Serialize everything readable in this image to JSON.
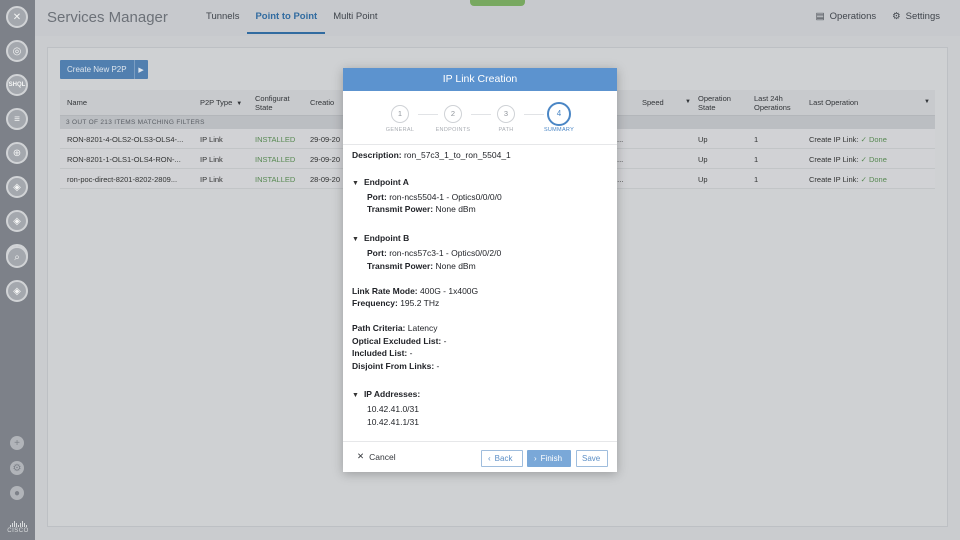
{
  "header": {
    "app_title": "Services Manager",
    "tabs": [
      {
        "label": "Tunnels",
        "active": false
      },
      {
        "label": "Point to Point",
        "active": true
      },
      {
        "label": "Multi Point",
        "active": false
      }
    ],
    "operations_label": "Operations",
    "settings_label": "Settings"
  },
  "rail": {
    "badge_label": "SHQL",
    "brand": "CISCO"
  },
  "main": {
    "create_button_label": "Create New P2P",
    "columns": [
      "Name",
      "P2P Type",
      "Configurat State",
      "Creatio",
      "Speed",
      "Operation State",
      "Last 24h Operations",
      "Last Operation"
    ],
    "filter_text": "3 OUT OF 213 ITEMS MATCHING FILTERS",
    "rows": [
      {
        "name": "RON-8201-4-OLS2-OLS3-OLS4-...",
        "type": "IP Link",
        "config": "INSTALLED",
        "created": "29-09-20",
        "trunc": "...",
        "op_state": "Up",
        "last24": "1",
        "last_op": "Create IP Link:",
        "status": "Done"
      },
      {
        "name": "RON-8201-1-OLS1-OLS4-RON-...",
        "type": "IP Link",
        "config": "INSTALLED",
        "created": "29-09-20",
        "trunc": "...",
        "op_state": "Up",
        "last24": "1",
        "last_op": "Create IP Link:",
        "status": "Done"
      },
      {
        "name": "ron-poc-direct-8201-8202-2809...",
        "type": "IP Link",
        "config": "INSTALLED",
        "created": "28-09-20",
        "trunc": "0...",
        "op_state": "Up",
        "last24": "1",
        "last_op": "Create IP Link:",
        "status": "Done"
      }
    ]
  },
  "modal": {
    "title": "IP Link Creation",
    "steps": [
      {
        "num": "1",
        "label": "GENERAL"
      },
      {
        "num": "2",
        "label": "ENDPOINTS"
      },
      {
        "num": "3",
        "label": "PATH"
      },
      {
        "num": "4",
        "label": "SUMMARY"
      }
    ],
    "active_step": 4,
    "description_label": "Description:",
    "description_value": "ron_57c3_1_to_ron_5504_1",
    "endpoint_a": {
      "title": "Endpoint A",
      "port_label": "Port:",
      "port_value": "ron-ncs5504-1 - Optics0/0/0/0",
      "power_label": "Transmit Power:",
      "power_value": "None dBm"
    },
    "endpoint_b": {
      "title": "Endpoint B",
      "port_label": "Port:",
      "port_value": "ron-ncs57c3-1 - Optics0/0/2/0",
      "power_label": "Transmit Power:",
      "power_value": "None dBm"
    },
    "link_rate_label": "Link Rate Mode:",
    "link_rate_value": "400G - 1x400G",
    "frequency_label": "Frequency:",
    "frequency_value": "195.2 THz",
    "path_criteria_label": "Path Criteria:",
    "path_criteria_value": "Latency",
    "optical_excluded_label": "Optical Excluded List:",
    "optical_excluded_value": "-",
    "included_label": "Included List:",
    "included_value": "-",
    "disjoint_label": "Disjoint From Links:",
    "disjoint_value": "-",
    "ip_title": "IP Addresses:",
    "ip_addresses": [
      "10.42.41.0/31",
      "10.42.41.1/31"
    ],
    "cancel_label": "Cancel",
    "back_label": "Back",
    "finish_label": "Finish",
    "save_label": "Save"
  },
  "colors": {
    "accent": "#5c93cf",
    "primary_button": "#4f7fb3",
    "installed": "#568a4f"
  }
}
